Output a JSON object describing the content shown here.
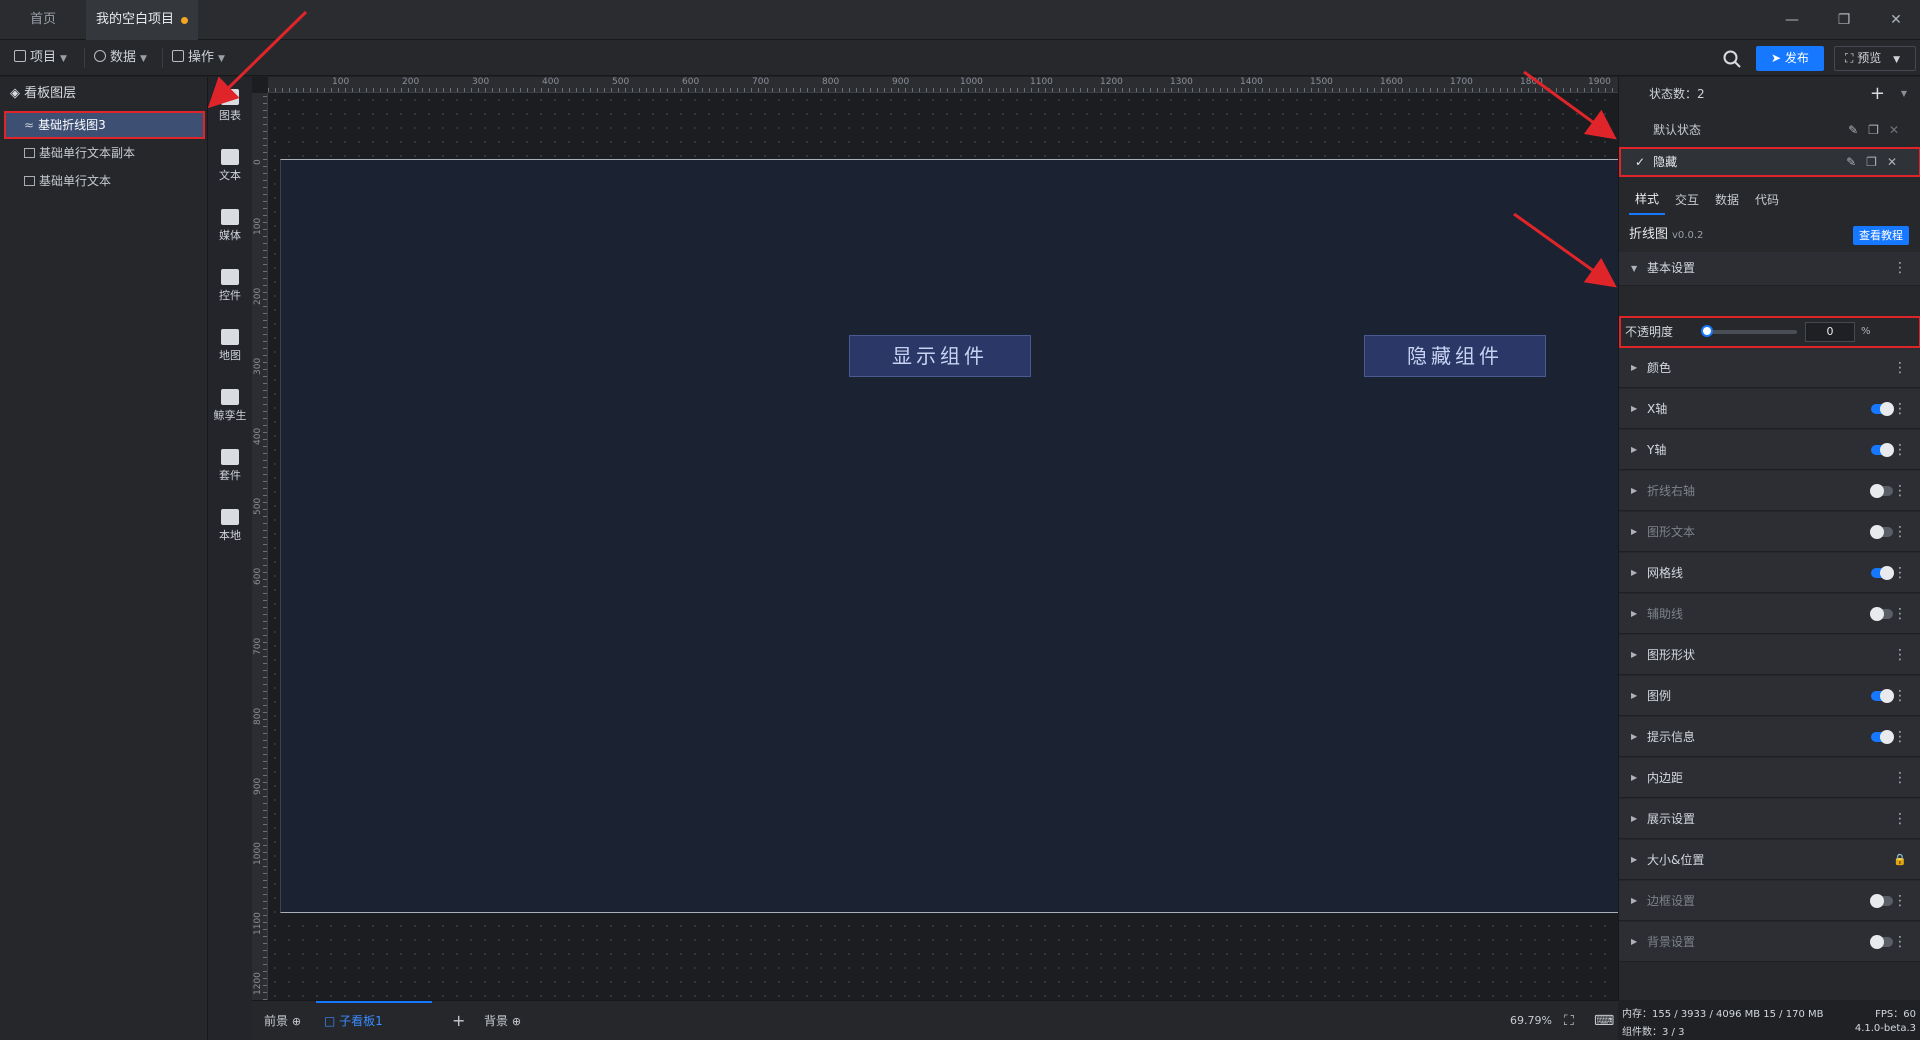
{
  "tabs": {
    "home": "首页",
    "project": "我的空白项目"
  },
  "toolbar": {
    "project": "项目",
    "data": "数据",
    "operate": "操作",
    "publish": "发布",
    "preview": "预览"
  },
  "layers": {
    "title": "看板图层",
    "items": [
      "基础折线图3",
      "基础单行文本副本",
      "基础单行文本"
    ]
  },
  "components": [
    "图表",
    "文本",
    "媒体",
    "控件",
    "地图",
    "鲸孪生",
    "套件",
    "本地"
  ],
  "ruler": {
    "top": [
      "100",
      "200",
      "300",
      "400",
      "500",
      "600",
      "700",
      "800",
      "900",
      "1000",
      "1100",
      "1200",
      "1300",
      "1400",
      "1500",
      "1600",
      "1700",
      "1800",
      "1900"
    ],
    "left": [
      "0",
      "100",
      "200",
      "300",
      "400",
      "500",
      "600",
      "700",
      "800",
      "900",
      "1000",
      "1100",
      "1200"
    ]
  },
  "canvas": {
    "show_btn": "显示组件",
    "hide_btn": "隐藏组件"
  },
  "bottom": {
    "front": "前景",
    "sub": "子看板1",
    "back": "背景",
    "zoom": "69.79%"
  },
  "states": {
    "count_label": "状态数：2",
    "default": "默认状态",
    "hidden": "隐藏"
  },
  "rtabs": [
    "样式",
    "交互",
    "数据",
    "代码"
  ],
  "component": {
    "name": "折线图",
    "version": "v0.0.2",
    "tutorial": "查看教程"
  },
  "basic": {
    "title": "基本设置",
    "opacity_label": "不透明度",
    "opacity_value": "0",
    "unit": "%"
  },
  "groups": [
    {
      "label": "颜色",
      "toggle": "none"
    },
    {
      "label": "X轴",
      "toggle": "on"
    },
    {
      "label": "Y轴",
      "toggle": "on"
    },
    {
      "label": "折线右轴",
      "toggle": "off"
    },
    {
      "label": "图形文本",
      "toggle": "off"
    },
    {
      "label": "网格线",
      "toggle": "on"
    },
    {
      "label": "辅助线",
      "toggle": "off"
    },
    {
      "label": "图形形状",
      "toggle": "none"
    },
    {
      "label": "图例",
      "toggle": "on"
    },
    {
      "label": "提示信息",
      "toggle": "on"
    },
    {
      "label": "内边距",
      "toggle": "none"
    },
    {
      "label": "展示设置",
      "toggle": "none"
    },
    {
      "label": "大小&位置",
      "toggle": "lock"
    },
    {
      "label": "边框设置",
      "toggle": "off"
    },
    {
      "label": "背景设置",
      "toggle": "off"
    }
  ],
  "status": {
    "memory": "内存：155 / 3933 / 4096 MB 15 / 170 MB",
    "fps": "FPS：60",
    "components": "组件数：3 / 3",
    "version": "4.1.0-beta.3"
  }
}
